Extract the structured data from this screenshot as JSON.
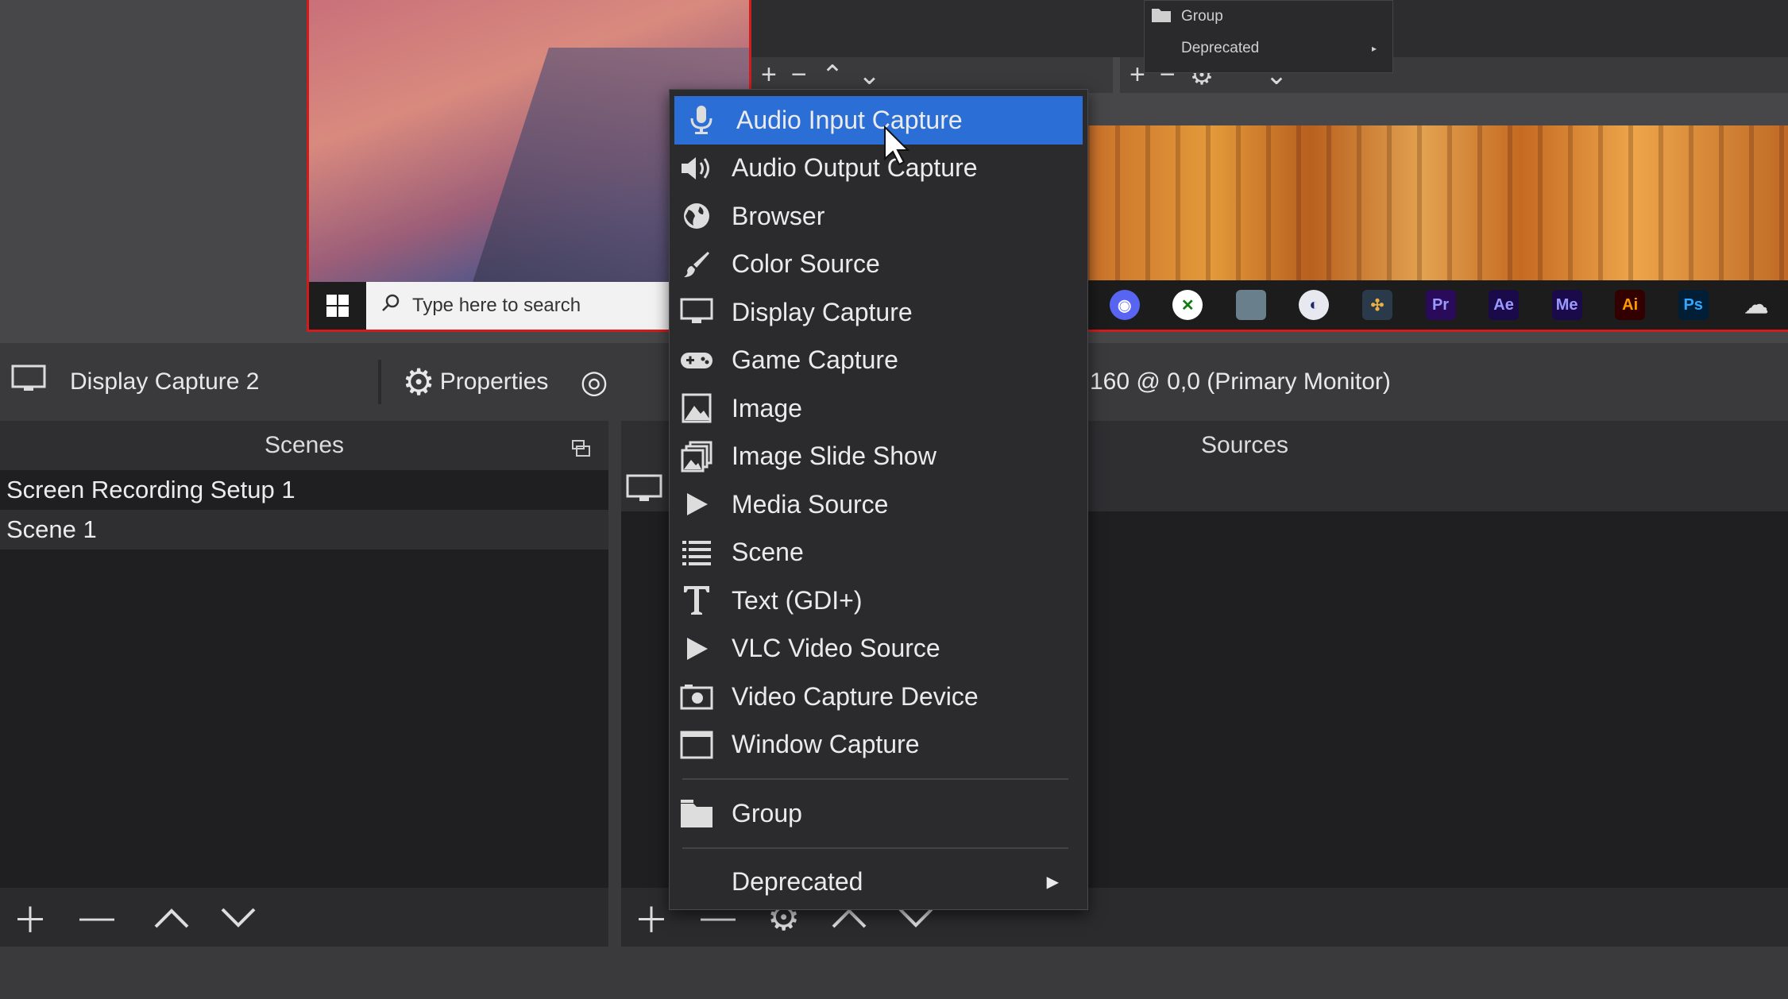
{
  "preview": {
    "search_placeholder": "Type here to search",
    "taskbar_apps": [
      "discord-icon",
      "xbox-icon",
      "game-icon",
      "cinema4d-icon",
      "resolve-icon",
      "Pr",
      "Ae",
      "Me",
      "Ai",
      "Ps",
      "cloud-icon"
    ]
  },
  "mini_menu": {
    "items": [
      "Group",
      "Deprecated"
    ]
  },
  "context_bar": {
    "source_name": "Display Capture 2",
    "properties_label": "Properties",
    "display_info": "160 @ 0,0 (Primary Monitor)"
  },
  "scenes": {
    "title": "Scenes",
    "items": [
      "Screen Recording Setup 1",
      "Scene 1"
    ]
  },
  "sources": {
    "title": "Sources"
  },
  "menu": {
    "items": [
      {
        "label": "Audio Input Capture",
        "icon": "microphone-icon"
      },
      {
        "label": "Audio Output Capture",
        "icon": "speaker-icon"
      },
      {
        "label": "Browser",
        "icon": "globe-icon"
      },
      {
        "label": "Color Source",
        "icon": "brush-icon"
      },
      {
        "label": "Display Capture",
        "icon": "monitor-icon"
      },
      {
        "label": "Game Capture",
        "icon": "gamepad-icon"
      },
      {
        "label": "Image",
        "icon": "image-icon"
      },
      {
        "label": "Image Slide Show",
        "icon": "slideshow-icon"
      },
      {
        "label": "Media Source",
        "icon": "play-icon"
      },
      {
        "label": "Scene",
        "icon": "list-icon"
      },
      {
        "label": "Text (GDI+)",
        "icon": "text-icon"
      },
      {
        "label": "VLC Video Source",
        "icon": "play-icon"
      },
      {
        "label": "Video Capture Device",
        "icon": "camera-icon"
      },
      {
        "label": "Window Capture",
        "icon": "window-icon"
      }
    ],
    "group_label": "Group",
    "deprecated_label": "Deprecated"
  },
  "colors": {
    "highlight": "#2b6fd6",
    "preview_border": "#d21c1c"
  }
}
